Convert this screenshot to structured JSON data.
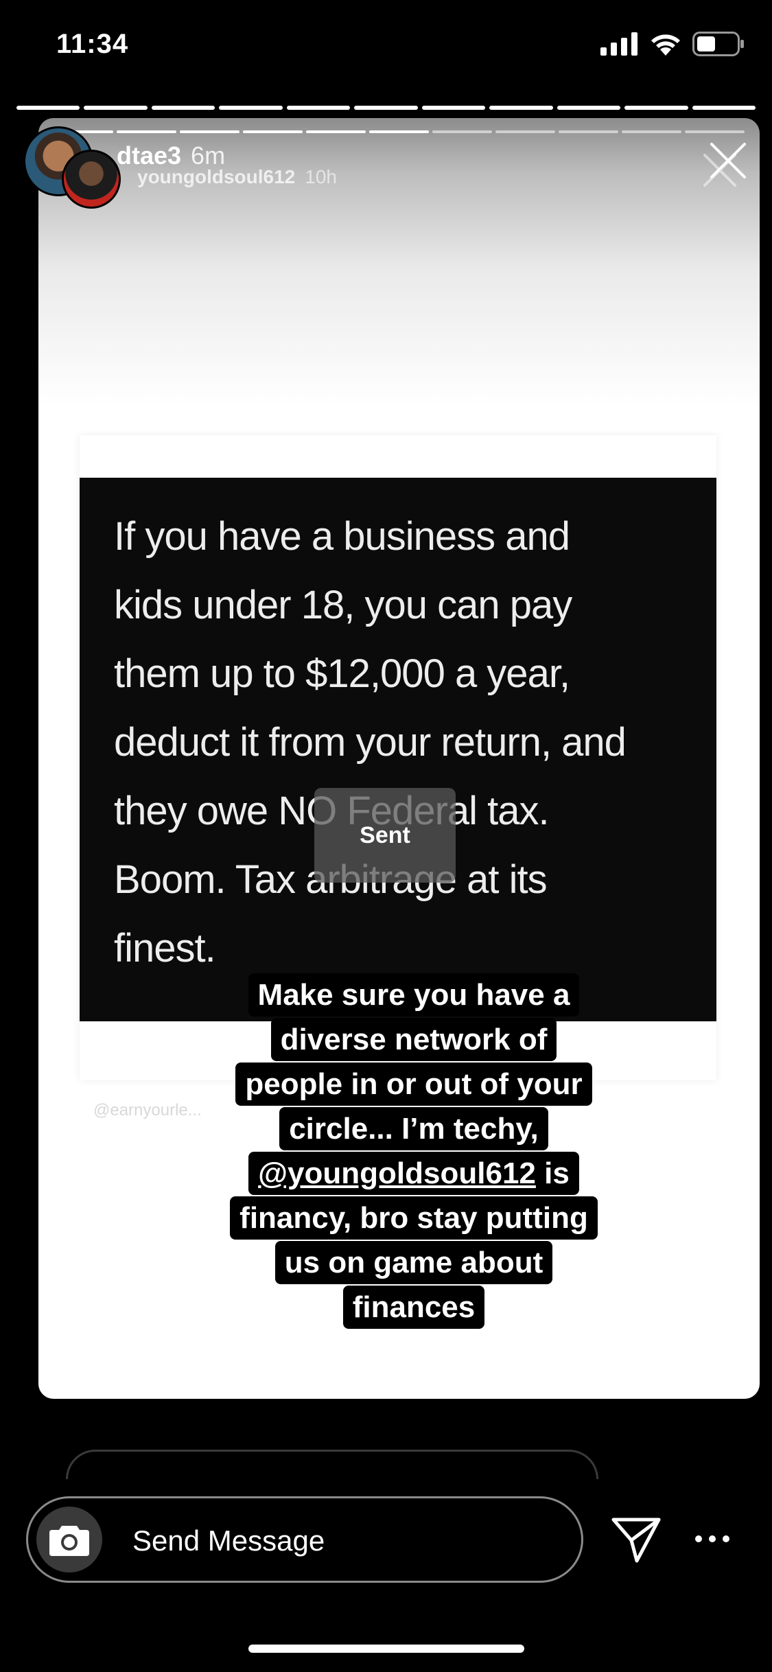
{
  "status_bar": {
    "time": "11:34"
  },
  "progress": {
    "total_segments": 11,
    "completed_segments": 11
  },
  "header": {
    "username": "dtae3",
    "time_ago": "6m"
  },
  "shared_story": {
    "username": "youngoldsoul612",
    "time_ago": "10h",
    "inner_progress": {
      "total_segments": 11,
      "completed_segments": 6
    }
  },
  "quote": {
    "lines": [
      "If you have a business and",
      "kids under 18, you can pay",
      "them up to $12,000 a year,",
      "deduct it from your return, and",
      "they owe NO Federal tax.",
      "Boom. Tax arbitrage at its",
      "finest."
    ],
    "watermark": "@earnyourle..."
  },
  "sent_label": "Sent",
  "caption": {
    "lines": [
      "Make sure you have a",
      "diverse network of",
      "people in or out of your",
      "circle... I’m techy,",
      "is",
      "financy, bro stay putting",
      "us on game about",
      "finances"
    ],
    "mention": "@youngoldsoul612"
  },
  "message_bar": {
    "placeholder": "Send Message"
  },
  "icons": {
    "camera": "camera-icon",
    "send": "paper-plane-icon",
    "more": "more-icon",
    "close": "close-icon"
  },
  "colors": {
    "background": "#000000",
    "quote_box": "#0b0b0b",
    "caption_bg": "#000000"
  }
}
